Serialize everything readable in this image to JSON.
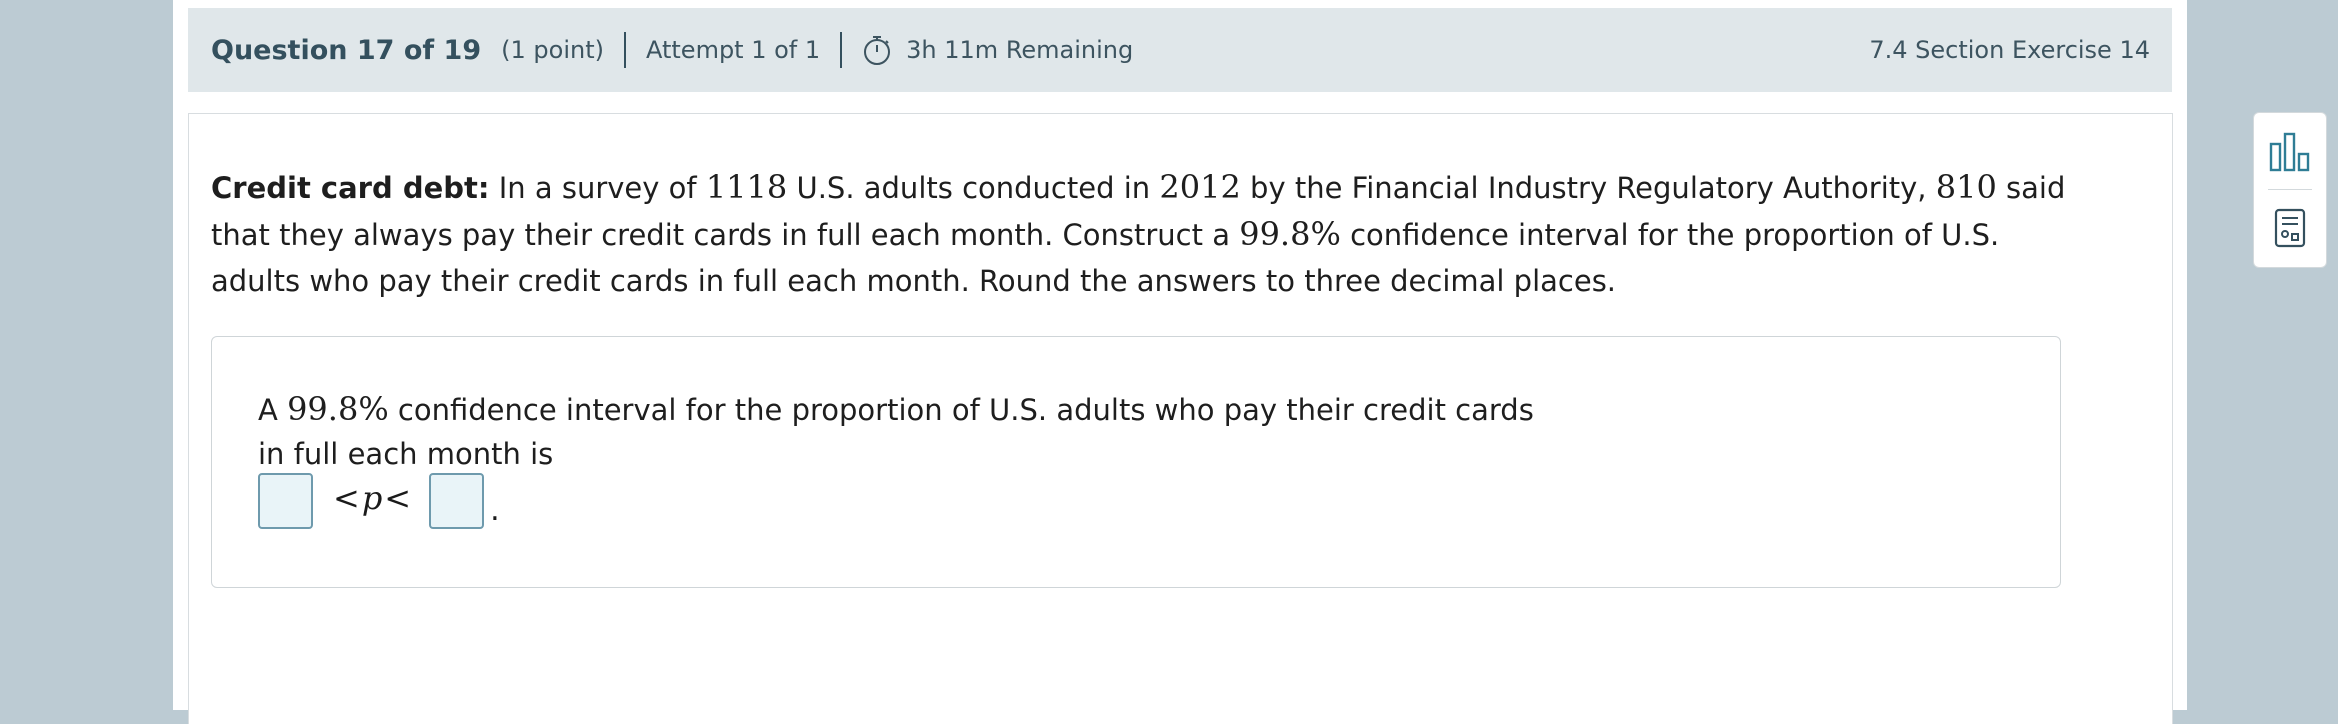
{
  "header": {
    "question": "Question 17 of 19",
    "points": "(1 point)",
    "attempt": "Attempt 1 of 1",
    "time_remaining": "3h 11m Remaining",
    "section": "7.4 Section Exercise 14"
  },
  "problem": {
    "bold_label": "Credit card debt:",
    "t1": " In a survey of ",
    "n1": "1118",
    "t2": " U.S. adults conducted in ",
    "n2": "2012",
    "t3": " by the Financial Industry Regulatory Authority, ",
    "n3": "810",
    "t4": " said that they always pay their credit cards in full each month. Construct a ",
    "n4": "99.8%",
    "t5": " confidence interval for the proportion of U.S. adults who pay their credit cards in full each month. Round the answers to three decimal places."
  },
  "answer": {
    "t1": "A ",
    "n1": "99.8%",
    "t2": " confidence interval for the proportion of U.S. adults who pay their credit cards in full each month is",
    "lower_value": "",
    "upper_value": "",
    "lt1": "<",
    "p": "p",
    "lt2": "<",
    "period": "."
  },
  "tools": {
    "icons": [
      "bar-chart-icon",
      "calculator-icon"
    ]
  }
}
